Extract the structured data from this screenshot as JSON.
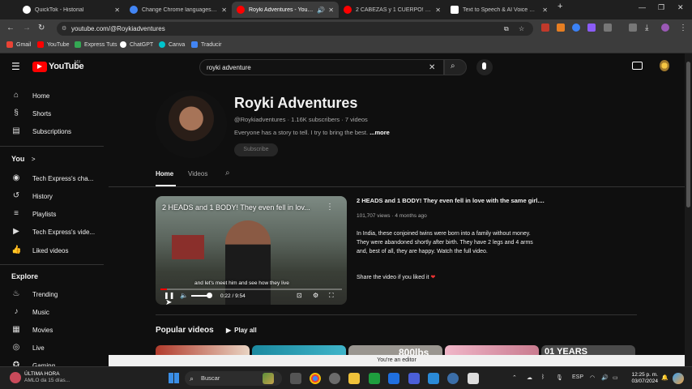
{
  "browser": {
    "tabs": [
      {
        "title": "QuickTok - Historial",
        "fav": "#ffffff"
      },
      {
        "title": "Change Chrome languages and...",
        "fav": "#4285f4"
      },
      {
        "title": "Royki Adventures - YouTube",
        "fav": "#ff0000"
      },
      {
        "title": "2 CABEZAS y 1 CUERPO! ¿Cómo...",
        "fav": "#ff0000"
      },
      {
        "title": "Text to Speech & AI Voice Gene...",
        "fav": "#ffffff"
      }
    ],
    "new_tab": "+",
    "url": "youtube.com/@Roykiadventures",
    "bookmarks": [
      {
        "label": "Gmail",
        "color": "#ea4335"
      },
      {
        "label": "YouTube",
        "color": "#ff0000"
      },
      {
        "label": "Express Tuts",
        "color": "#34a853"
      },
      {
        "label": "ChatGPT",
        "color": "#ffffff"
      },
      {
        "label": "Canva",
        "color": "#00c4cc"
      },
      {
        "label": "Traducir",
        "color": "#4285f4"
      }
    ]
  },
  "youtube": {
    "logo": "YouTube",
    "country": "MX",
    "search_value": "royki adventure",
    "sidebar": {
      "main": [
        "Home",
        "Shorts",
        "Subscriptions"
      ],
      "you_label": "You",
      "you_chevron": ">",
      "you": [
        "Tech Express's cha...",
        "History",
        "Playlists",
        "Tech Express's vide...",
        "Liked videos"
      ],
      "explore_label": "Explore",
      "explore": [
        "Trending",
        "Music",
        "Movies",
        "Live",
        "Gaming"
      ]
    },
    "channel": {
      "name": "Royki Adventures",
      "handle": "@Roykiadventures",
      "subscribers": "1.16K subscribers",
      "videos": "7 videos",
      "description": "Everyone has a story to tell. I try to bring the best.",
      "more": "...more",
      "subscribe": "Subscribe"
    },
    "tabs": [
      "Home",
      "Videos"
    ],
    "featured": {
      "player_title": "2 HEADS and 1 BODY! They even fell in lov...",
      "caption": "and let's meet him and see how they live",
      "time": "0:22 / 9:54",
      "progress": 0.037,
      "title": "2 HEADS and 1 BODY! They even fell in love with the same girl....",
      "views": "101,707 views",
      "ago": "4 months ago",
      "description": "In India, these conjoined twins were born into a family without money. They were abandoned shortly after birth. They have 2 legs and 4 arms and, best of all, they are happy. Watch the full video.",
      "share": "Share the video if you liked it",
      "heart": "❤"
    },
    "popular_label": "Popular videos",
    "play_all": "Play all",
    "thumb_text": [
      "800lbs",
      "01 YEARS"
    ],
    "editor_banner": "You're an editor"
  },
  "taskbar": {
    "weather_title": "ÚLTIMA HORA",
    "weather_sub": "AMLO da 15 días...",
    "search": "Buscar",
    "lang": "ESP",
    "time": "12:25 p. m.",
    "date": "03/07/2024"
  }
}
